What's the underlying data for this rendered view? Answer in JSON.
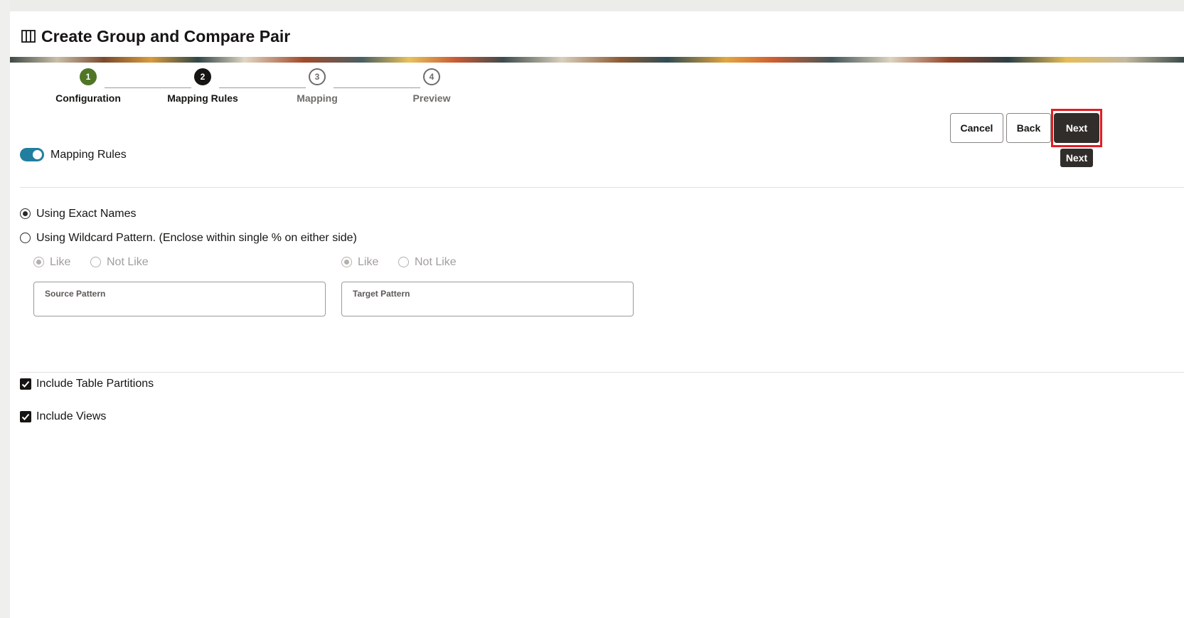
{
  "header": {
    "title": "Create Group and Compare Pair",
    "icon": "columns-icon"
  },
  "stepper": {
    "steps": [
      {
        "number": "1",
        "label": "Configuration",
        "state": "completed"
      },
      {
        "number": "2",
        "label": "Mapping Rules",
        "state": "active"
      },
      {
        "number": "3",
        "label": "Mapping",
        "state": "upcoming"
      },
      {
        "number": "4",
        "label": "Preview",
        "state": "upcoming"
      }
    ]
  },
  "actions": {
    "cancel": "Cancel",
    "back": "Back",
    "next": "Next",
    "tooltip": "Next"
  },
  "mapping_rules": {
    "toggle_label": "Mapping Rules",
    "toggle_on": true,
    "exact_names_label": "Using Exact Names",
    "wildcard_label": "Using Wildcard Pattern. (Enclose within single % on either side)",
    "selected": "exact",
    "source": {
      "like": "Like",
      "not_like": "Not Like",
      "selected": "like",
      "field_label": "Source Pattern",
      "value": ""
    },
    "target": {
      "like": "Like",
      "not_like": "Not Like",
      "selected": "like",
      "field_label": "Target Pattern",
      "value": ""
    }
  },
  "options": {
    "include_partitions": {
      "label": "Include Table Partitions",
      "checked": true
    },
    "include_views": {
      "label": "Include Views",
      "checked": true
    }
  },
  "colors": {
    "completed": "#4f7626",
    "active": "#161513",
    "toggle": "#227e9e",
    "highlight": "#e11d22",
    "primary_button": "#312d2a"
  }
}
